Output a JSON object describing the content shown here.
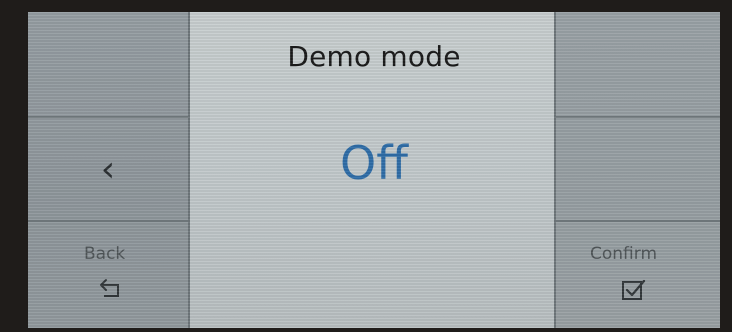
{
  "screen": {
    "title": "Demo mode",
    "value": "Off"
  },
  "navigation": {
    "prev_glyph": "‹",
    "back_label": "Back",
    "back_icon": "return-arrow-icon",
    "confirm_label": "Confirm",
    "confirm_icon": "checkbox-check-icon"
  },
  "colors": {
    "value_text": "#2f6ea8",
    "title_text": "#1a1a1a"
  }
}
